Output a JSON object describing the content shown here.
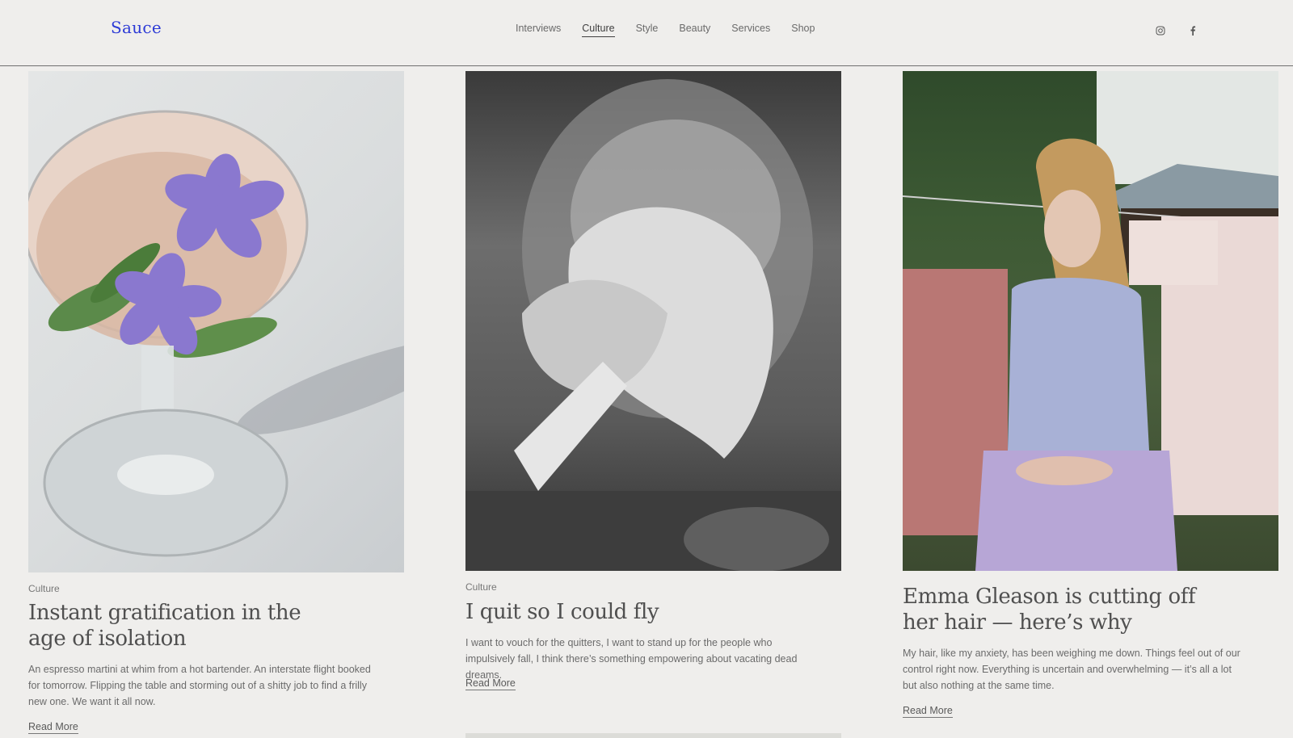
{
  "header": {
    "logo": "Sauce",
    "nav": [
      {
        "label": "Interviews"
      },
      {
        "label": "Culture",
        "active": true
      },
      {
        "label": "Style"
      },
      {
        "label": "Beauty"
      },
      {
        "label": "Services"
      },
      {
        "label": "Shop"
      }
    ],
    "social": [
      "instagram-icon",
      "facebook-icon"
    ]
  },
  "articles": [
    {
      "category": "Culture",
      "title": "Instant gratification in the age of isolation",
      "excerpt": "An espresso martini at whim from a hot bartender. An interstate flight booked for tomorrow. Flipping the table and storming out of a shitty job to find a frilly new one. We want it all now.",
      "read_more": "Read More"
    },
    {
      "category": "Culture",
      "title": "I quit so I could fly",
      "excerpt": "I want to vouch for the quitters, I want to stand up for the people who impulsively fall, I think there’s something empowering about vacating dead dreams.",
      "read_more": "Read More"
    },
    {
      "title": "Emma Gleason is cutting off her hair — here’s why",
      "excerpt": "My hair, like my anxiety, has been weighing me down. Things feel out of our control right now. Everything is uncertain and overwhelming — it’s all a lot but also nothing at the same time.",
      "read_more": "Read More"
    }
  ],
  "colors": {
    "background": "#efeeec",
    "logo": "#2d3bd6",
    "text": "#5a5a5a"
  }
}
